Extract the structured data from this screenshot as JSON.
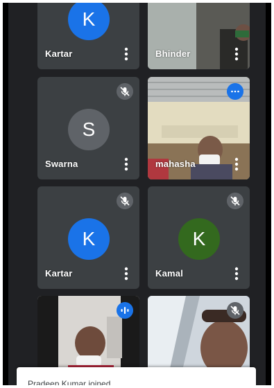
{
  "participants": [
    {
      "name": "Kartar",
      "initial": "K",
      "avatar_color": "#1a73e8"
    },
    {
      "name": "Bhinder"
    },
    {
      "name": "Swarna",
      "initial": "S",
      "avatar_color": "#5f6368"
    },
    {
      "name": "mahasha"
    },
    {
      "name": "Kartar",
      "initial": "K",
      "avatar_color": "#1a73e8"
    },
    {
      "name": "Kamal",
      "initial": "K",
      "avatar_color": "#33691e"
    }
  ],
  "toast": {
    "message": "Pradeep Kumar joined"
  }
}
